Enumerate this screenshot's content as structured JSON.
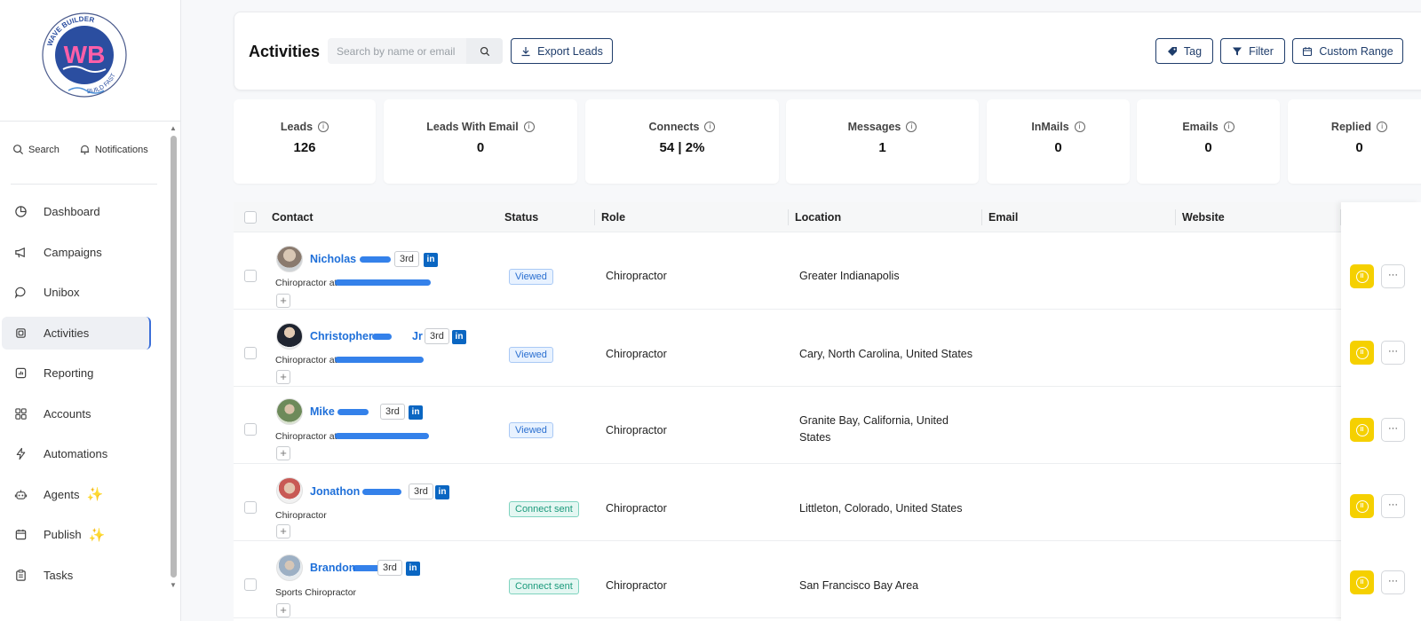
{
  "brand": {
    "logo_initials": "WB",
    "logo_top_text": "WAVE BUILDER",
    "logo_bottom_text": "BUILD FAST"
  },
  "quick_links": {
    "search": "Search",
    "notifications": "Notifications"
  },
  "nav": [
    {
      "label": "Dashboard",
      "icon": "pie-chart-icon",
      "active": false
    },
    {
      "label": "Campaigns",
      "icon": "megaphone-icon",
      "active": false
    },
    {
      "label": "Unibox",
      "icon": "chat-bubble-icon",
      "active": false
    },
    {
      "label": "Activities",
      "icon": "activity-icon",
      "active": true
    },
    {
      "label": "Reporting",
      "icon": "report-icon",
      "active": false
    },
    {
      "label": "Accounts",
      "icon": "grid-icon",
      "active": false
    },
    {
      "label": "Automations",
      "icon": "lightning-icon",
      "active": false
    },
    {
      "label": "Agents",
      "icon": "robot-icon",
      "active": false,
      "sparkle": true
    },
    {
      "label": "Publish",
      "icon": "calendar-icon",
      "active": false,
      "sparkle": true
    },
    {
      "label": "Tasks",
      "icon": "clipboard-icon",
      "active": false
    }
  ],
  "header": {
    "title": "Activities",
    "search_placeholder": "Search by name or email",
    "export_label": "Export Leads",
    "tag_label": "Tag",
    "filter_label": "Filter",
    "range_label": "Custom Range"
  },
  "stats": [
    {
      "label": "Leads",
      "value": "126"
    },
    {
      "label": "Leads With Email",
      "value": "0"
    },
    {
      "label": "Connects",
      "value": "54 | 2%"
    },
    {
      "label": "Messages",
      "value": "1"
    },
    {
      "label": "InMails",
      "value": "0"
    },
    {
      "label": "Emails",
      "value": "0"
    },
    {
      "label": "Replied",
      "value": "0"
    }
  ],
  "table": {
    "columns": [
      "Contact",
      "Status",
      "Role",
      "Location",
      "Email",
      "Website"
    ],
    "rows": [
      {
        "name": "Nicholas",
        "degree": "3rd",
        "subtitle": "Chiropractor at",
        "status": "Viewed",
        "role": "Chiropractor",
        "location_line1": "Greater Indianapolis",
        "location_line2": "",
        "email": "",
        "website": ""
      },
      {
        "name": "Christopher",
        "name_suffix": "Jr",
        "degree": "3rd",
        "subtitle": "Chiropractor at",
        "status": "Viewed",
        "role": "Chiropractor",
        "location_line1": "Cary, North Carolina, United States",
        "location_line2": "",
        "email": "",
        "website": ""
      },
      {
        "name": "Mike",
        "degree": "3rd",
        "subtitle": "Chiropractor at",
        "status": "Viewed",
        "role": "Chiropractor",
        "location_line1": "Granite Bay, California, United",
        "location_line2": "States",
        "email": "",
        "website": ""
      },
      {
        "name": "Jonathon",
        "degree": "3rd",
        "subtitle": "Chiropractor",
        "status": "Connect sent",
        "role": "Chiropractor",
        "location_line1": "Littleton, Colorado, United States",
        "location_line2": "",
        "email": "",
        "website": ""
      },
      {
        "name": "Brandon",
        "degree": "3rd",
        "subtitle": "Sports Chiropractor",
        "status": "Connect sent",
        "role": "Chiropractor",
        "location_line1": "San Francisco Bay Area",
        "location_line2": "",
        "email": "",
        "website": ""
      }
    ]
  },
  "linkedin_glyph": "in",
  "more_glyph": "···",
  "pause_glyph": "II",
  "plus_glyph": "+",
  "info_glyph": "i",
  "sparkle_glyph": "✨",
  "colors": {
    "accent": "#1e6fd9",
    "pause": "#f5d000",
    "linkedin": "#0a66c2",
    "button_border": "#1f3d6b"
  }
}
